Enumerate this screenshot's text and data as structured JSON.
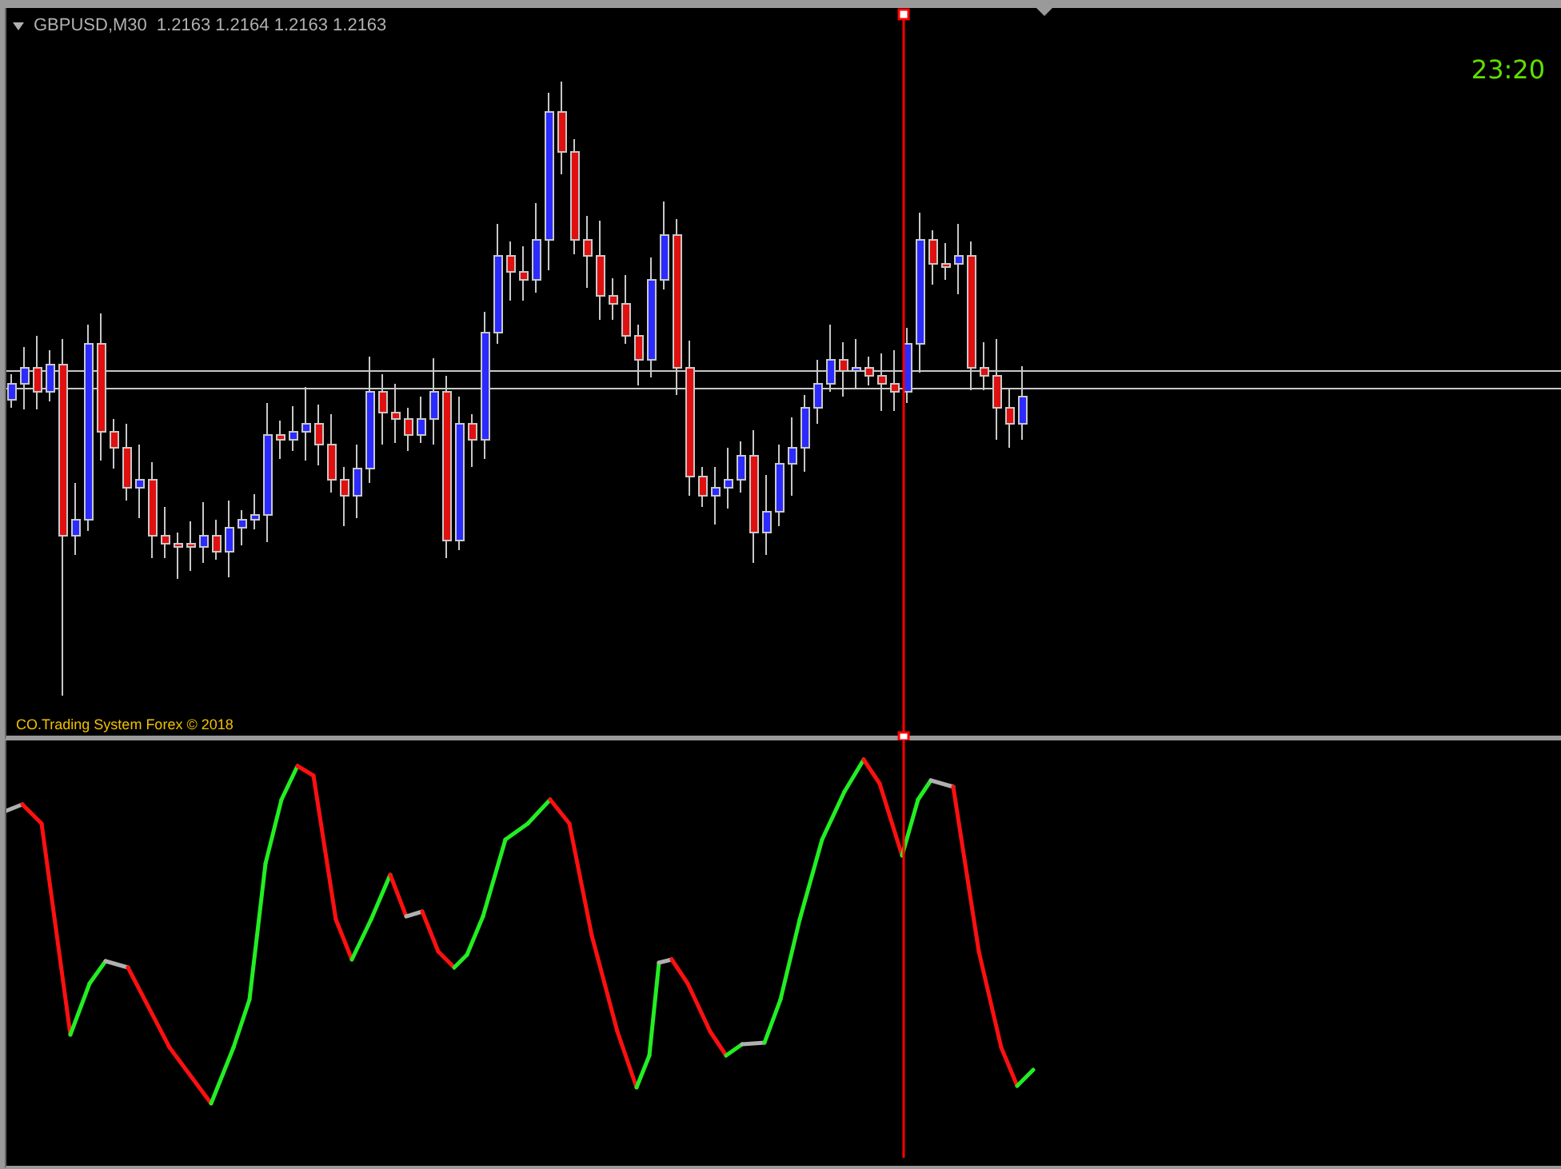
{
  "chart": {
    "header": {
      "symbol_timeframe": "GBPUSD,M30",
      "quotes": "1.2163 1.2164 1.2163 1.2163"
    },
    "clock": "23:20",
    "copyright": "CO.Trading System Forex © 2018"
  }
}
